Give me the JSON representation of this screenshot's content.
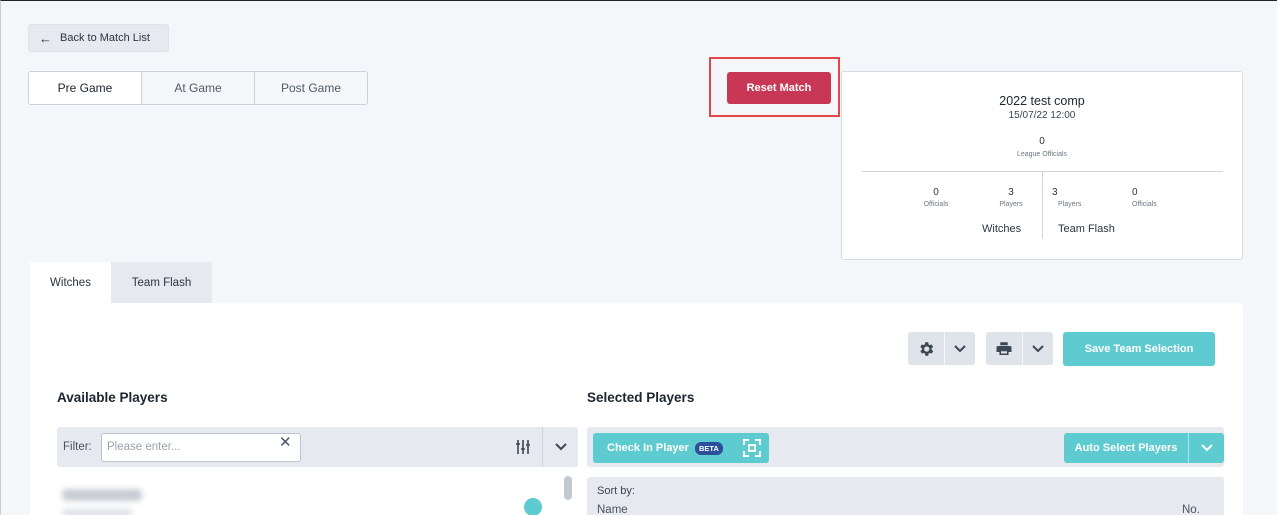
{
  "nav": {
    "back_label": "Back to Match List"
  },
  "phase_tabs": [
    {
      "label": "Pre Game",
      "active": true
    },
    {
      "label": "At Game",
      "active": false
    },
    {
      "label": "Post Game",
      "active": false
    }
  ],
  "reset_button": {
    "label": "Reset Match",
    "color": "#c93756",
    "highlight_color": "#e04848"
  },
  "match_card": {
    "competition": "2022 test comp",
    "datetime": "15/07/22 12:00",
    "league_officials": {
      "count": "0",
      "label": "League Officials"
    },
    "home": {
      "officials_count": "0",
      "officials_label": "Officials",
      "players_count": "3",
      "players_label": "Players",
      "name": "Witches"
    },
    "away": {
      "players_count": "3",
      "players_label": "Players",
      "officials_count": "0",
      "officials_label": "Officials",
      "name": "Team Flash"
    }
  },
  "team_tabs": [
    {
      "label": "Witches",
      "active": true
    },
    {
      "label": "Team Flash",
      "active": false
    }
  ],
  "toolbar": {
    "settings_icon": "gear-icon",
    "print_icon": "printer-icon",
    "save_label": "Save Team Selection",
    "accent": "#5ecbd1"
  },
  "available": {
    "heading": "Available Players",
    "filter_label": "Filter:",
    "filter_placeholder": "Please enter...",
    "filter_value": ""
  },
  "selected": {
    "heading": "Selected Players",
    "checkin_label": "Check In Player",
    "beta_badge": "BETA",
    "auto_select_label": "Auto Select Players",
    "sort_by_label": "Sort by:",
    "sort_name": "Name",
    "sort_no": "No."
  }
}
